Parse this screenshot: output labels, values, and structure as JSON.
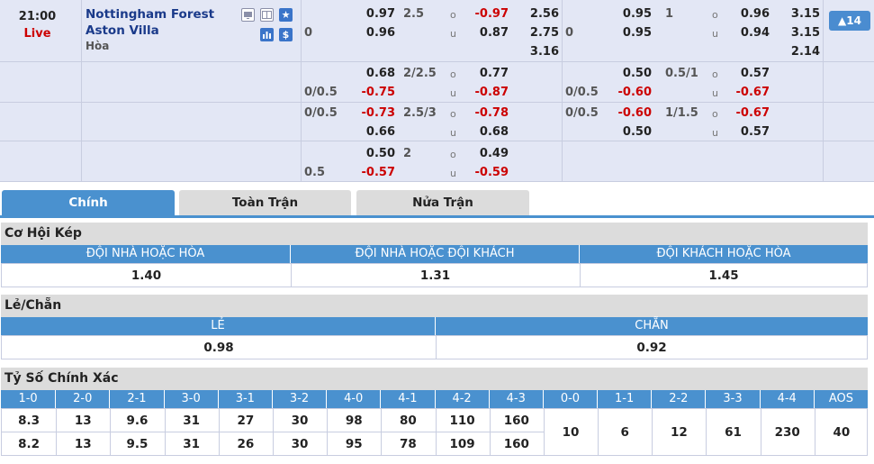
{
  "match": {
    "time": "21:00",
    "status": "Live",
    "home_team": "Nottingham Forest",
    "away_team": "Aston Villa",
    "draw_label": "Hòa",
    "more_badge": "14"
  },
  "odds_rows": [
    {
      "ft_hdp_home": "",
      "ft_home": "0.97",
      "ft_hdp_away": "0",
      "ft_away": "0.96",
      "ft_ou_line": "2.5",
      "ft_over": "-0.97",
      "ft_under": "0.87",
      "ft_1x2": [
        "2.56",
        "2.75",
        "3.16"
      ],
      "ht_hdp_home": "",
      "ht_home": "0.95",
      "ht_hdp_away": "0",
      "ht_away": "0.95",
      "ht_ou_line": "1",
      "ht_over": "0.96",
      "ht_under": "0.94",
      "ht_1x2": [
        "3.15",
        "3.15",
        "2.14"
      ]
    },
    {
      "ft_home": "0.68",
      "ft_hdp_away": "0/0.5",
      "ft_away": "-0.75",
      "ft_ou_line": "2/2.5",
      "ft_over": "0.77",
      "ft_under": "-0.87",
      "ht_home": "0.50",
      "ht_hdp_away": "0/0.5",
      "ht_away": "-0.60",
      "ht_ou_line": "0.5/1",
      "ht_over": "0.57",
      "ht_under": "-0.67"
    },
    {
      "ft_hdp_home": "0/0.5",
      "ft_home": "-0.73",
      "ft_away": "0.66",
      "ft_ou_line": "2.5/3",
      "ft_over": "-0.78",
      "ft_under": "0.68",
      "ht_hdp_home": "0/0.5",
      "ht_home": "-0.60",
      "ht_away": "0.50",
      "ht_ou_line": "1/1.5",
      "ht_over": "-0.67",
      "ht_under": "0.57"
    },
    {
      "ft_home": "0.50",
      "ft_hdp_away": "0.5",
      "ft_away": "-0.57",
      "ft_ou_line": "2",
      "ft_over": "0.49",
      "ft_under": "-0.59"
    }
  ],
  "ou_labels": {
    "over": "o",
    "under": "u"
  },
  "tabs": [
    "Chính",
    "Toàn Trận",
    "Nửa Trận"
  ],
  "double_chance": {
    "title": "Cơ Hội Kép",
    "headers": [
      "ĐỘI NHÀ HOẶC HÒA",
      "ĐỘI NHÀ HOẶC ĐỘI KHÁCH",
      "ĐỘI KHÁCH HOẶC HÒA"
    ],
    "values": [
      "1.40",
      "1.31",
      "1.45"
    ]
  },
  "odd_even": {
    "title": "Lẻ/Chẵn",
    "headers": [
      "LẺ",
      "CHẴN"
    ],
    "values": [
      "0.98",
      "0.92"
    ]
  },
  "correct_score": {
    "title": "Tỷ Số Chính Xác",
    "headers": [
      "1-0",
      "2-0",
      "2-1",
      "3-0",
      "3-1",
      "3-2",
      "4-0",
      "4-1",
      "4-2",
      "4-3",
      "0-0",
      "1-1",
      "2-2",
      "3-3",
      "4-4",
      "AOS"
    ],
    "home_row": [
      "8.3",
      "13",
      "9.6",
      "31",
      "27",
      "30",
      "98",
      "80",
      "110",
      "160"
    ],
    "away_row": [
      "8.2",
      "13",
      "9.5",
      "31",
      "26",
      "30",
      "95",
      "78",
      "109",
      "160"
    ],
    "draws": [
      "10",
      "6",
      "12",
      "61",
      "230",
      "40"
    ]
  }
}
